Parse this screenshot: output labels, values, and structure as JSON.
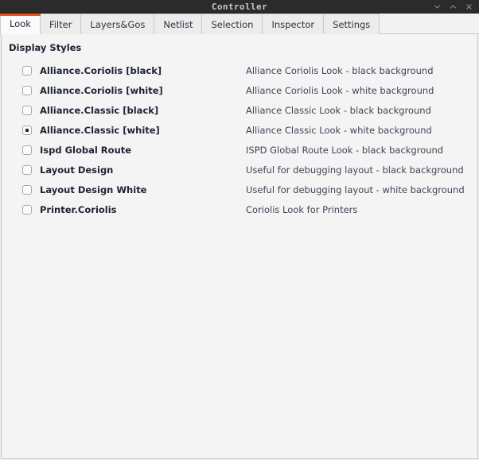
{
  "window": {
    "title": "Controller",
    "controls": [
      {
        "name": "minimize-button",
        "icon": "chevron-down-icon"
      },
      {
        "name": "maximize-button",
        "icon": "chevron-up-icon"
      },
      {
        "name": "close-button",
        "icon": "close-icon"
      }
    ]
  },
  "tabs": [
    {
      "label": "Look",
      "active": true
    },
    {
      "label": "Filter",
      "active": false
    },
    {
      "label": "Layers&Gos",
      "active": false
    },
    {
      "label": "Netlist",
      "active": false
    },
    {
      "label": "Selection",
      "active": false
    },
    {
      "label": "Inspector",
      "active": false
    },
    {
      "label": "Settings",
      "active": false
    }
  ],
  "look_tab": {
    "group_title": "Display Styles",
    "selected_style": "Alliance.Classic [white]",
    "styles": [
      {
        "label": "Alliance.Coriolis [black]",
        "description": "Alliance Coriolis Look - black background",
        "checked": false
      },
      {
        "label": "Alliance.Coriolis [white]",
        "description": "Alliance Coriolis Look - white background",
        "checked": false
      },
      {
        "label": "Alliance.Classic [black]",
        "description": "Alliance Classic Look - black background",
        "checked": false
      },
      {
        "label": "Alliance.Classic [white]",
        "description": "Alliance Classic Look - white background",
        "checked": true
      },
      {
        "label": "Ispd Global Route",
        "description": "ISPD Global Route Look - black background",
        "checked": false
      },
      {
        "label": "Layout Design",
        "description": "Useful for debugging layout - black background",
        "checked": false
      },
      {
        "label": "Layout Design White",
        "description": "Useful for debugging layout - white background",
        "checked": false
      },
      {
        "label": "Printer.Coriolis",
        "description": "Coriolis Look for Printers",
        "checked": false
      }
    ]
  },
  "colors": {
    "titlebar_background": "#2b2b2b",
    "titlebar_text": "#c8c8c8",
    "accent": "#e2571e",
    "panel_background": "#f4f4f4",
    "label_text": "#1c2333",
    "description_text": "#3c4656"
  }
}
